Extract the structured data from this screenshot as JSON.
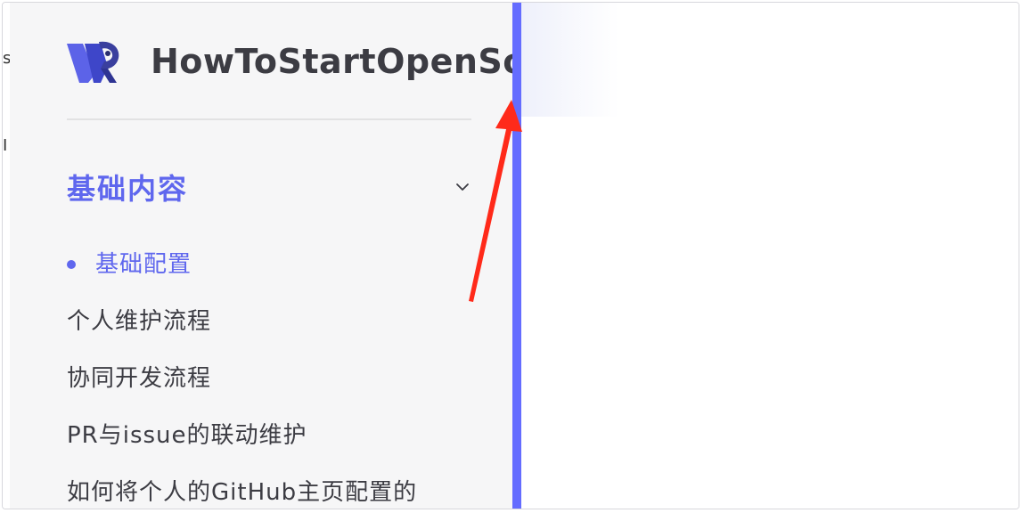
{
  "brand": {
    "title": "HowToStartOpenSou",
    "logo_icon": "vp-logo-icon"
  },
  "background": {
    "ghost_char_1": "s",
    "ghost_char_2": "I"
  },
  "sidebar": {
    "section": {
      "title": "基础内容",
      "expanded": true,
      "toggle_icon": "chevron-down-icon"
    },
    "items": [
      {
        "label": "基础配置",
        "active": true
      },
      {
        "label": "个人维护流程",
        "active": false
      },
      {
        "label": "协同开发流程",
        "active": false
      },
      {
        "label": "PR与issue的联动维护",
        "active": false
      },
      {
        "label": "如何将个人的GitHub主页配置的",
        "active": false
      }
    ]
  },
  "annotation": {
    "arrow_icon": "red-arrow-icon",
    "color": "#ff2a1a"
  },
  "colors": {
    "accent": "#5f67ee",
    "resize_bar": "#646cff",
    "sidebar_bg": "#f6f6f7",
    "text": "#3c3c43"
  }
}
